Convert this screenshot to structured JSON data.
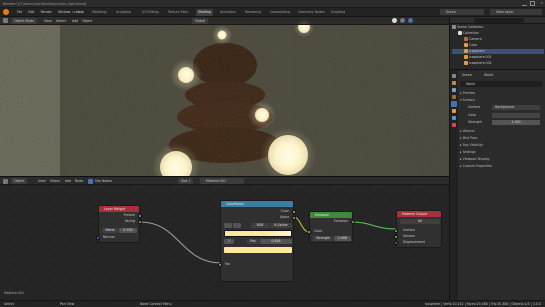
{
  "titlebar": {
    "title": "Blender* [C:\\Users\\User\\Desktop\\ice\\ice_light.blend]"
  },
  "menus": [
    "File",
    "Edit",
    "Render",
    "Window",
    "Help"
  ],
  "workspace_tabs": [
    "Layout",
    "Modeling",
    "Sculpting",
    "UV Editing",
    "Texture Paint",
    "Shading",
    "Animation",
    "Rendering",
    "Compositing",
    "Geometry Nodes",
    "Scripting"
  ],
  "active_workspace": "Shading",
  "scene": {
    "label": "Scene",
    "view_layer": "View Layer"
  },
  "viewport": {
    "mode": "Object Mode",
    "menus": [
      "View",
      "Select",
      "Add",
      "Object"
    ],
    "shading_label": "Global"
  },
  "outliner": {
    "title": "Scene Collection",
    "items": [
      {
        "label": "Collection",
        "selected": false
      },
      {
        "label": "Camera",
        "selected": false
      },
      {
        "label": "Cube",
        "selected": false
      },
      {
        "label": "Icosphere",
        "selected": true
      },
      {
        "label": "Icosphere.001",
        "selected": false
      },
      {
        "label": "Icosphere.002",
        "selected": false
      }
    ]
  },
  "properties": {
    "tabs": [
      "Scene",
      "World"
    ],
    "object_name": "World",
    "panels": [
      "Preview",
      "Surface",
      "Volume",
      "Mist Pass",
      "Ray Visibility",
      "Settings",
      "Viewport Display",
      "Custom Properties"
    ],
    "surface_label": "Surface",
    "surface_value": "Background",
    "color_label": "Color",
    "strength_label": "Strength",
    "strength_value": "1.000"
  },
  "node_editor": {
    "menus": [
      "Object",
      "View",
      "Select",
      "Add",
      "Node"
    ],
    "use_nodes": "Use Nodes",
    "slot": "Slot 1",
    "material": "Material.001",
    "nodes": {
      "layer_weight": {
        "title": "Layer Weight",
        "out1": "Fresnel",
        "out2": "Facing",
        "blend_label": "Blend",
        "blend_value": "0.700",
        "normal": "Normal"
      },
      "color_ramp": {
        "title": "ColorRamp",
        "out1": "Color",
        "out2": "Alpha",
        "mode": "RGB",
        "interp": "B-Spline",
        "pos_label": "Pos",
        "pos_value": "0.618",
        "index": "1",
        "fac": "Fac"
      },
      "emission": {
        "title": "Emission",
        "out": "Emission",
        "in1": "Color",
        "strength_label": "Strength",
        "strength_value": "1.000"
      },
      "material_output": {
        "title": "Material Output",
        "target": "All",
        "in1": "Surface",
        "in2": "Volume",
        "in3": "Displacement"
      }
    }
  },
  "statusbar": {
    "left": "Select",
    "mid": "Pan View",
    "right": "Node Context Menu",
    "stats": "Icosphere | Verts:10,242 | Faces:20,480 | Tris:20,480 | Objects:1/5 | 3.0.0"
  },
  "colors": {
    "accent": "#4772b3",
    "layer_weight": "#a8303d",
    "color_ramp": "#3b7ea1",
    "emission": "#3c8a3a",
    "material_output": "#a8303d",
    "socket_yellow": "#c7c729",
    "socket_gray": "#a1a1a1",
    "socket_green": "#63c763"
  }
}
